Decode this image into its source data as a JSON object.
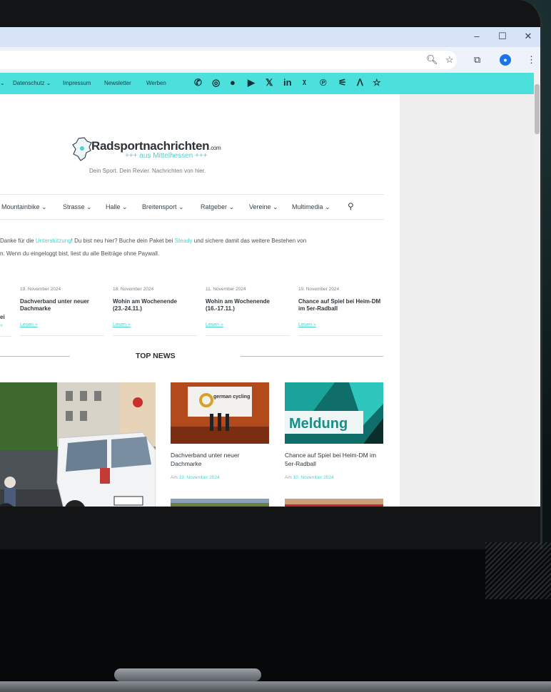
{
  "browser": {
    "window_controls": [
      "–",
      "☐",
      "✕"
    ],
    "toolbar_icons": [
      "zoom-icon",
      "star-icon",
      "extensions-icon",
      "profile-icon",
      "menu-icon"
    ]
  },
  "topbar": {
    "links": [
      "Datenschutz ⌄",
      "Impressum",
      "Newsletter",
      "Werben"
    ],
    "leading_chevron": "⌄",
    "social_icons": [
      "whatsapp-icon",
      "instagram-icon",
      "facebook-icon",
      "youtube-icon",
      "x-icon",
      "linkedin-icon",
      "xing-icon",
      "pinterest-icon",
      "rss-icon",
      "strava-icon",
      "star-icon"
    ],
    "social_glyphs": [
      "✆",
      "◎",
      "●",
      "▶",
      "𝕏",
      "in",
      "ᵡ",
      "℗",
      "⚟",
      "ᐱ",
      "☆"
    ]
  },
  "site": {
    "logo_title": "Radsportnachrichten",
    "logo_tld": ".com",
    "logo_sub": "+++ aus Mittelhessen +++",
    "tagline": "Dein Sport. Dein Revier. Nachrichten von hier."
  },
  "mainnav": [
    "Mountainbike ⌄",
    "Strasse ⌄",
    "Halle ⌄",
    "Breitensport ⌄",
    "Ratgeber ⌄",
    "Vereine ⌄",
    "Multimedia ⌄"
  ],
  "notice": {
    "line1_a": "Danke für die ",
    "line1_link1": "Unterstützung",
    "line1_b": "! Du bist neu hier? Buche dein Paket bei ",
    "line1_link2": "Steady",
    "line1_c": " und sichere damit das weitere Bestehen von",
    "line2": "n. Wenn du eingeloggt bist, liest du alle Beiträge ohne Paywall."
  },
  "ticker": [
    {
      "date": "19. November 2024",
      "title": "Dachverband unter neuer Dachmarke",
      "more": "Lesen »"
    },
    {
      "date": "18. November 2024",
      "title": "Wohin am Wochenende (23.-24.11.)",
      "more": "Lesen »"
    },
    {
      "date": "11. November 2024",
      "title": "Wohin am Wochenende (16.-17.11.)",
      "more": "Lesen »"
    },
    {
      "date": "10. November 2024",
      "title": "Chance auf Spiel bei Heim-DM im 5er-Radball",
      "more": "Lesen »"
    }
  ],
  "ticker_partial": {
    "title_fragment": "ei",
    "more": "»"
  },
  "top_news": {
    "heading": "TOP NEWS",
    "cards": [
      {
        "title": "Dachverband unter neuer Dachmarke",
        "date_prefix": "Am ",
        "date": "19. November 2024",
        "image_text": "german cycling"
      },
      {
        "title": "Chance auf Spiel bei Heim-DM im 5er-Radball",
        "date_prefix": "Am ",
        "date": "10. November 2024",
        "image_text": "Meldung"
      }
    ]
  },
  "colors": {
    "accent": "#4be0dc",
    "link": "#4fd0cc",
    "brand_dark": "#2d3338"
  }
}
